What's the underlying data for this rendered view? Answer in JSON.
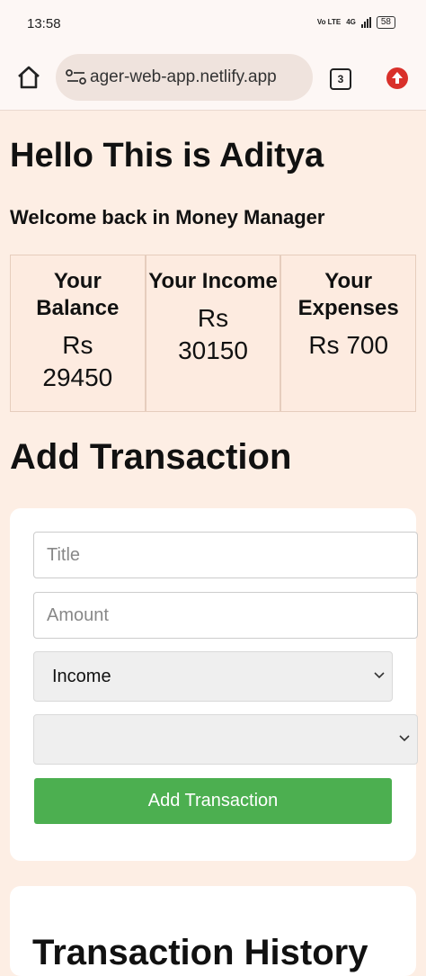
{
  "status": {
    "time": "13:58",
    "volte": "Vo LTE",
    "network": "4G",
    "battery": "58"
  },
  "browser": {
    "url": "ager-web-app.netlify.app",
    "tab_count": "3"
  },
  "header": {
    "title": "Hello This is Aditya",
    "subtitle": "Welcome back in Money Manager"
  },
  "summary": [
    {
      "label": "Your Balance",
      "value": "Rs 29450"
    },
    {
      "label": "Your Income",
      "value": "Rs 30150"
    },
    {
      "label": "Your Expenses",
      "value": "Rs 700"
    }
  ],
  "add_transaction": {
    "title": "Add Transaction",
    "title_placeholder": "Title",
    "amount_placeholder": "Amount",
    "type_selected": "Income",
    "category_selected": "",
    "button_label": "Add Transaction"
  },
  "history": {
    "title": "Transaction History"
  },
  "colors": {
    "accent_green": "#4caf50",
    "page_bg": "#fdeee4",
    "update_red": "#d9302a"
  }
}
